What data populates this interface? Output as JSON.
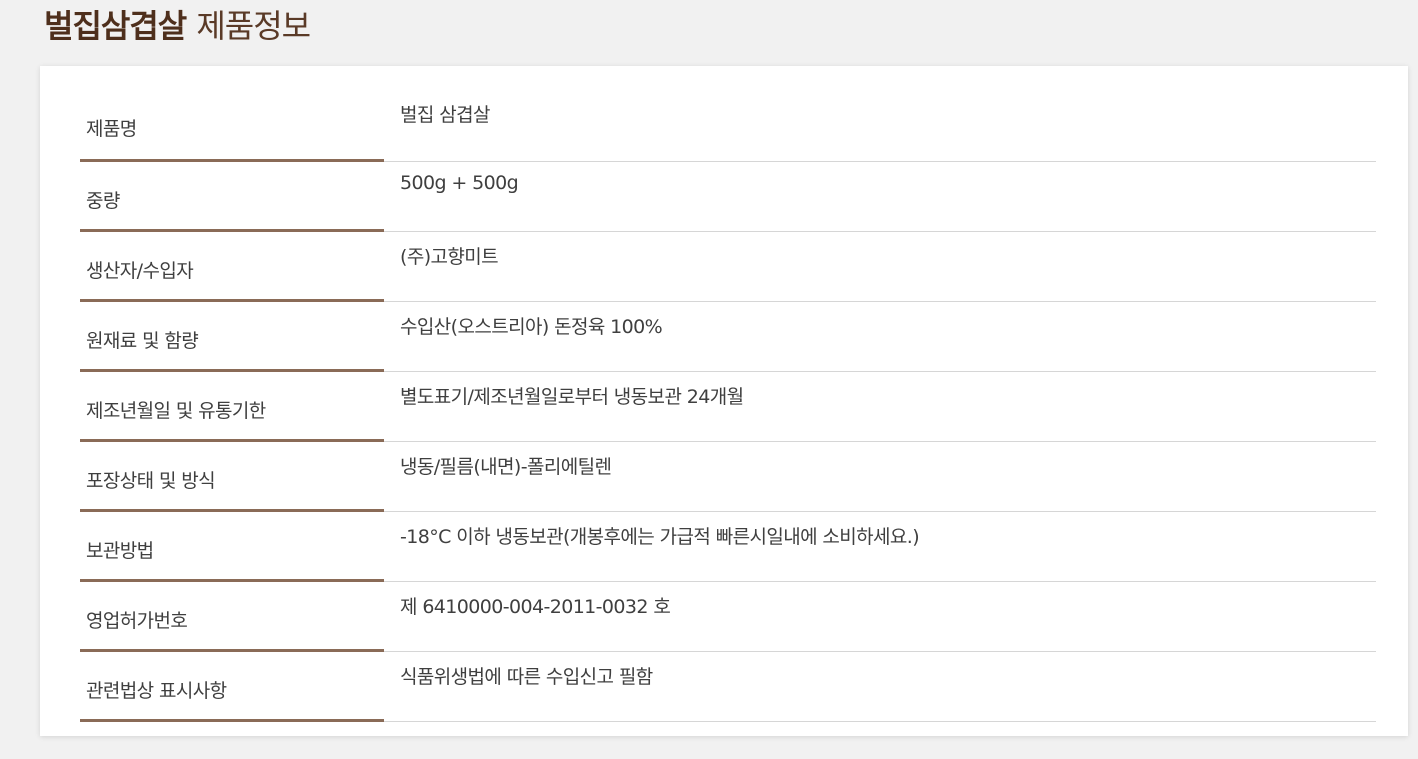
{
  "header": {
    "title_bold": "벌집삼겹살",
    "title_light": "제품정보"
  },
  "colors": {
    "background": "#f1f1f1",
    "card": "#ffffff",
    "title": "#4e2f1c",
    "label_underline": "#8a6b57",
    "value_divider": "#d6d6d6",
    "text": "#3f3f3f"
  },
  "product_info": {
    "rows": [
      {
        "label": "제품명",
        "value": "벌집 삼겹살"
      },
      {
        "label": "중량",
        "value": "500g + 500g"
      },
      {
        "label": "생산자/수입자",
        "value": "(주)고향미트"
      },
      {
        "label": "원재료 및 함량",
        "value": "수입산(오스트리아) 돈정육 100%"
      },
      {
        "label": "제조년월일 및 유통기한",
        "value": "별도표기/제조년월일로부터 냉동보관 24개월"
      },
      {
        "label": "포장상태 및 방식",
        "value": "냉동/필름(내면)-폴리에틸렌"
      },
      {
        "label": "보관방법",
        "value": "-18°C 이하 냉동보관(개봉후에는 가급적 빠른시일내에 소비하세요.)"
      },
      {
        "label": "영업허가번호",
        "value": "제 6410000-004-2011-0032 호"
      },
      {
        "label": "관련법상 표시사항",
        "value": "식품위생법에 따른 수입신고 필함"
      }
    ]
  }
}
